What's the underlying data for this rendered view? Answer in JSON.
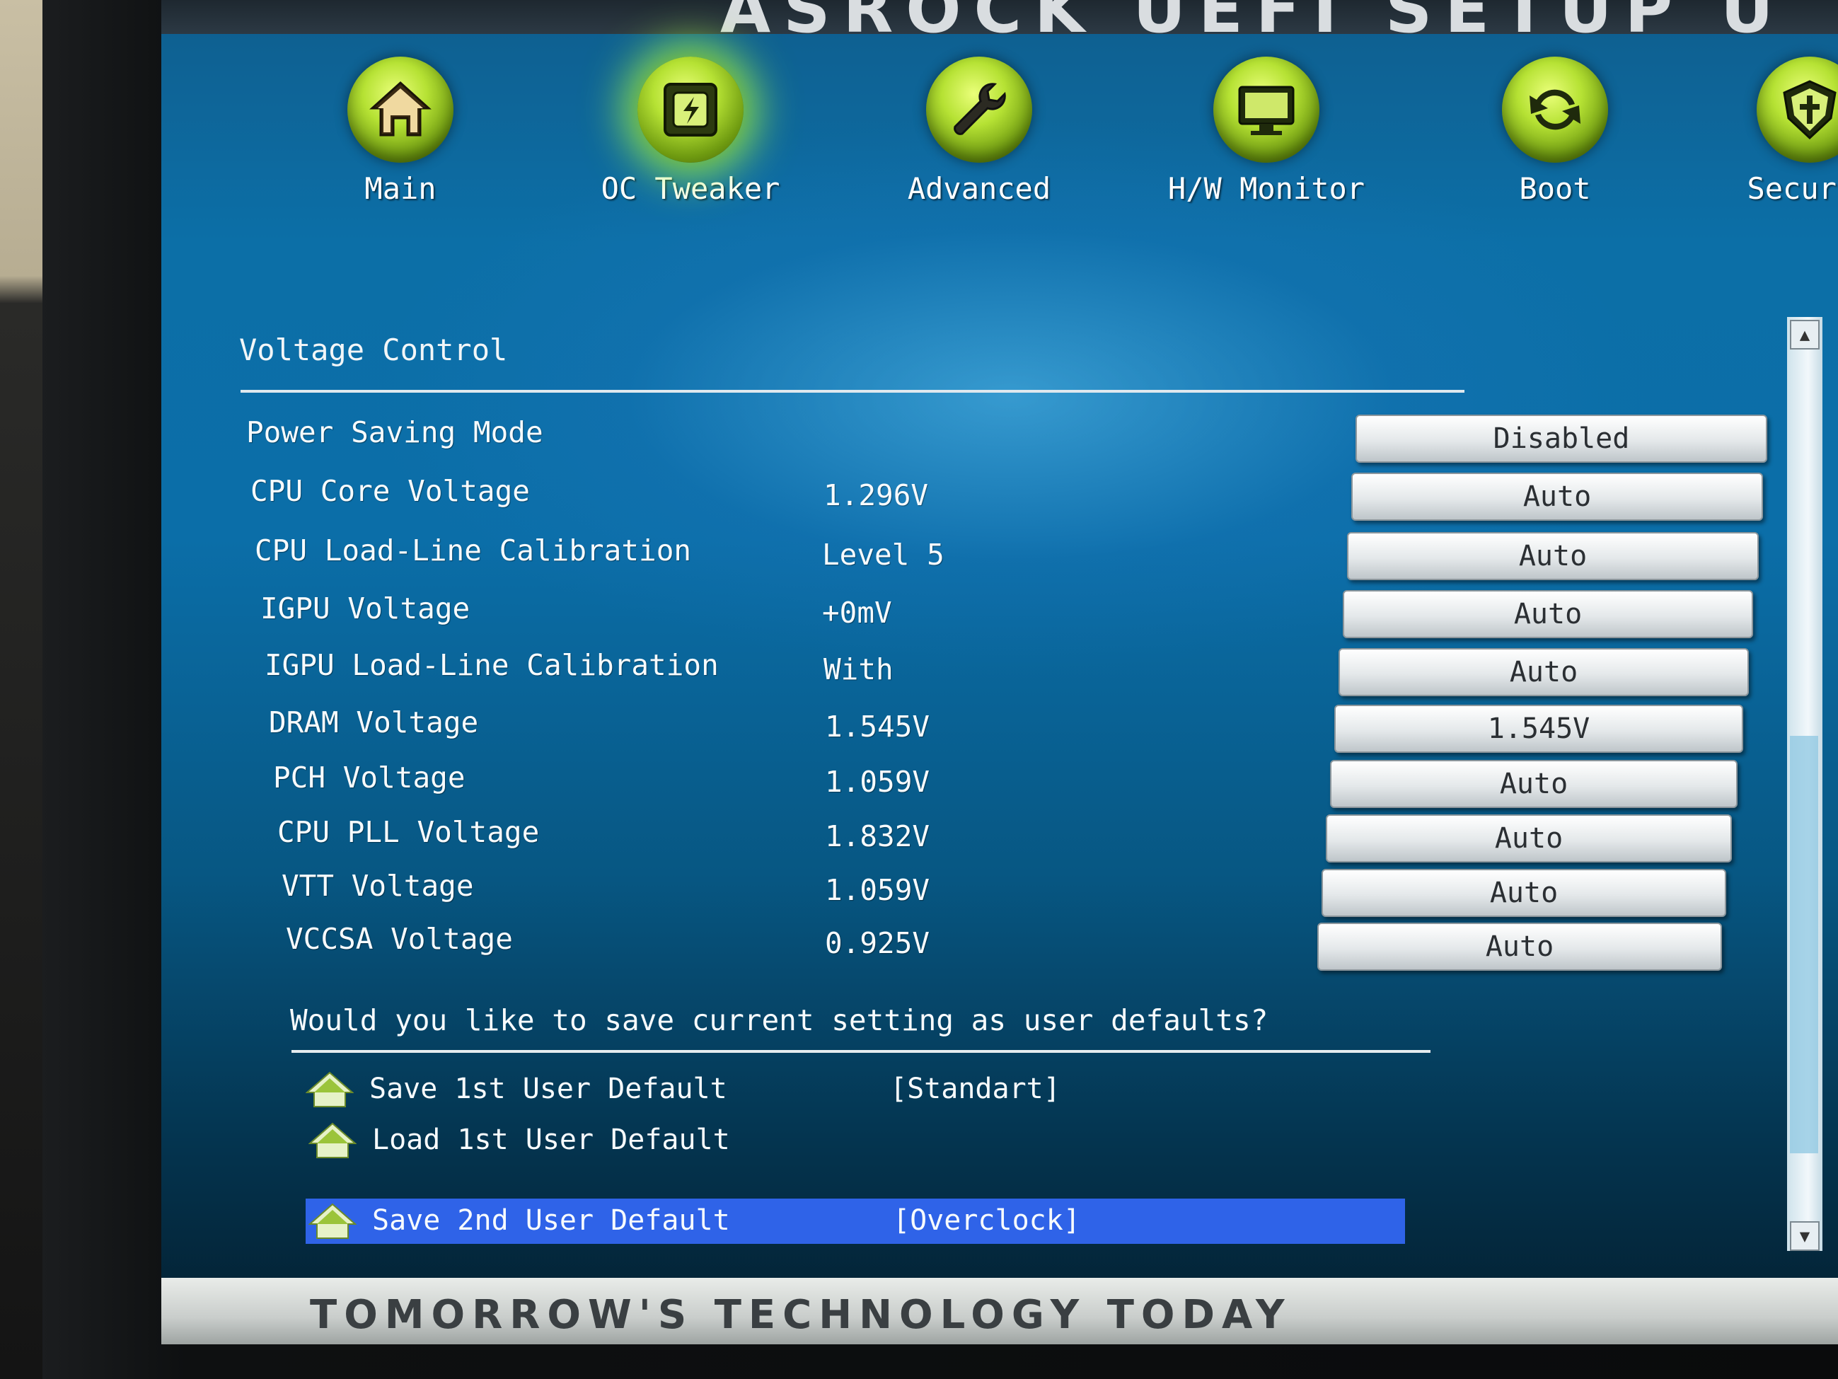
{
  "header": {
    "title": "ASROCK UEFI SETUP U"
  },
  "tabs": [
    {
      "label": "Main",
      "icon": "home-icon"
    },
    {
      "label": "OC Tweaker",
      "icon": "oc-chip-icon"
    },
    {
      "label": "Advanced",
      "icon": "wrench-icon"
    },
    {
      "label": "H/W Monitor",
      "icon": "monitor-icon"
    },
    {
      "label": "Boot",
      "icon": "refresh-icon"
    },
    {
      "label": "Securit",
      "icon": "shield-icon"
    }
  ],
  "active_tab": "OC Tweaker",
  "section": {
    "title": "Voltage Control"
  },
  "settings": [
    {
      "label": "Power Saving Mode",
      "value": "",
      "option": "Disabled"
    },
    {
      "label": "CPU Core Voltage",
      "value": "1.296V",
      "option": "Auto"
    },
    {
      "label": "CPU Load-Line Calibration",
      "value": "Level 5",
      "option": "Auto"
    },
    {
      "label": "IGPU Voltage",
      "value": "+0mV",
      "option": "Auto"
    },
    {
      "label": "IGPU Load-Line Calibration",
      "value": "With",
      "option": "Auto"
    },
    {
      "label": "DRAM Voltage",
      "value": "1.545V",
      "option": "1.545V"
    },
    {
      "label": "PCH Voltage",
      "value": "1.059V",
      "option": "Auto"
    },
    {
      "label": "CPU PLL Voltage",
      "value": "1.832V",
      "option": "Auto"
    },
    {
      "label": "VTT Voltage",
      "value": "1.059V",
      "option": "Auto"
    },
    {
      "label": "VCCSA Voltage",
      "value": "0.925V",
      "option": "Auto"
    }
  ],
  "user_defaults": {
    "question": "Would you like to save current setting as user defaults?",
    "items": [
      {
        "label": "Save 1st User Default",
        "value": "[Standart]"
      },
      {
        "label": "Load 1st User Default",
        "value": ""
      },
      {
        "label": "Save 2nd User Default",
        "value": "[Overclock]",
        "selected": true
      }
    ]
  },
  "scrollbar": {
    "up_glyph": "▲",
    "down_glyph": "▼"
  },
  "footer": {
    "text": "TOMORROW'S TECHNOLOGY TODAY"
  },
  "colors": {
    "accent_green": "#b6e234",
    "selection_blue": "#2f63e8",
    "background_blue": "#0b6ea8"
  }
}
